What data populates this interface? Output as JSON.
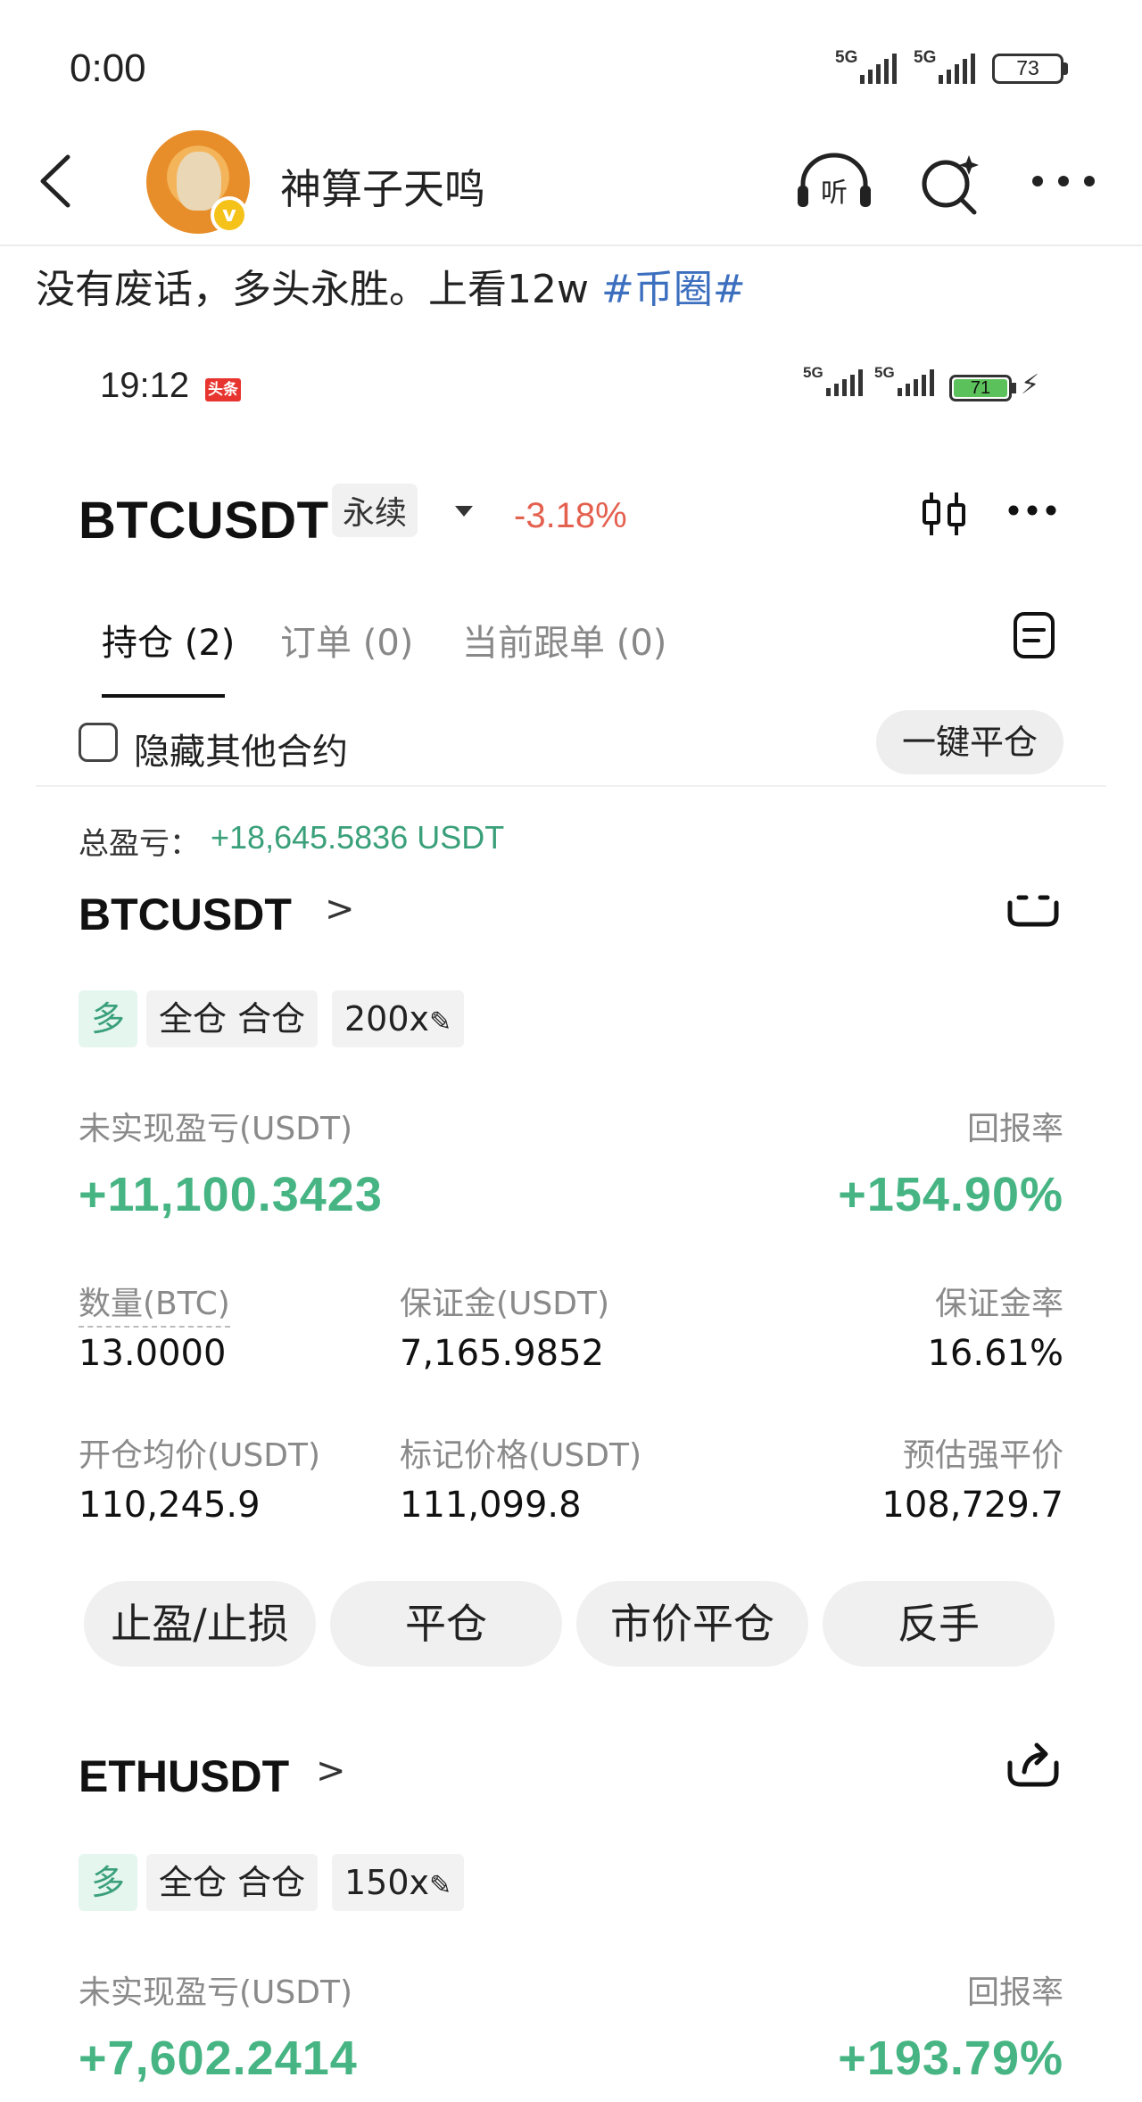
{
  "status_outer": {
    "time": "0:00",
    "sim1": "5G",
    "sim2": "5G",
    "battery": "73"
  },
  "nav": {
    "author": "神算子天鸣",
    "badge": "v"
  },
  "post": {
    "text": "没有废话，多头永胜。上看12w ",
    "tag": "#币圈#"
  },
  "status_inner": {
    "time": "19:12",
    "app_badge": "头条",
    "sim1": "5G",
    "sim2": "5G",
    "battery": "71",
    "charging": "⚡"
  },
  "header": {
    "pair": "BTCUSDT",
    "contract_type": "永续",
    "change": "-3.18%"
  },
  "tabs": [
    {
      "label": "持仓 (2)",
      "active": true
    },
    {
      "label": "订单 (0)",
      "active": false
    },
    {
      "label": "当前跟单 (0)",
      "active": false
    }
  ],
  "filter": {
    "hide_label": "隐藏其他合约",
    "hide_checked": false,
    "close_all": "一键平仓"
  },
  "summary": {
    "total_label": "总盈亏：",
    "total_value": "+18,645.5836 USDT"
  },
  "positions": [
    {
      "symbol": "BTCUSDT",
      "chevron": ">",
      "side": "多",
      "margin_mode": "全仓 合仓",
      "leverage": "200x",
      "unrealized_label": "未实现盈亏(USDT)",
      "unrealized_value": "+11,100.3423",
      "roe_label": "回报率",
      "roe_value": "+154.90%",
      "qty_label": "数量(BTC)",
      "qty_value": "13.0000",
      "margin_label": "保证金(USDT)",
      "margin_value": "7,165.9852",
      "margin_ratio_label": "保证金率",
      "margin_ratio_value": "16.61%",
      "entry_label": "开仓均价(USDT)",
      "entry_value": "110,245.9",
      "mark_label": "标记价格(USDT)",
      "mark_value": "111,099.8",
      "liq_label": "预估强平价",
      "liq_value": "108,729.7",
      "actions": [
        "止盈/止损",
        "平仓",
        "市价平仓",
        "反手"
      ]
    },
    {
      "symbol": "ETHUSDT",
      "chevron": ">",
      "side": "多",
      "margin_mode": "全仓 合仓",
      "leverage": "150x",
      "unrealized_label": "未实现盈亏(USDT)",
      "unrealized_value": "+7,602.2414",
      "roe_label": "回报率",
      "roe_value": "+193.79%"
    }
  ],
  "colors": {
    "profit_green": "#46b483",
    "loss_red": "#e4604f",
    "tag_blue": "#3d6fbf"
  }
}
